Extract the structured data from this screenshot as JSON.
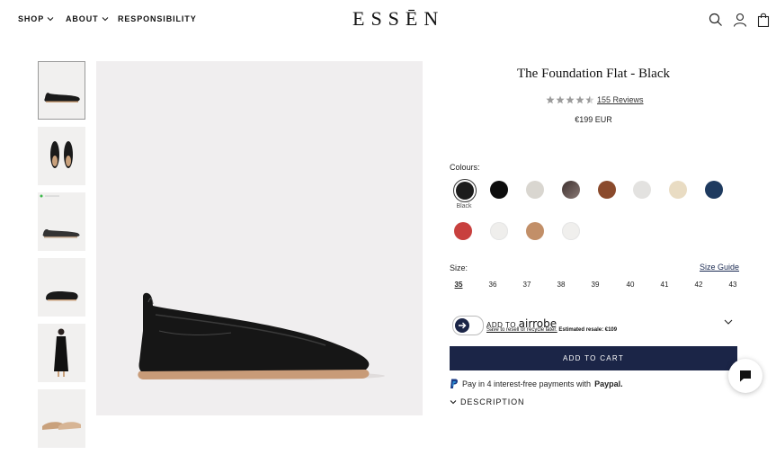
{
  "header": {
    "nav": [
      {
        "label": "SHOP",
        "has_dropdown": true
      },
      {
        "label": "ABOUT",
        "has_dropdown": true
      },
      {
        "label": "RESPONSIBILITY",
        "has_dropdown": false
      }
    ],
    "logo": "ESSĒN",
    "icons": [
      "search-icon",
      "account-icon",
      "cart-bag-icon"
    ]
  },
  "gallery": {
    "thumbnails": [
      "side-view",
      "top-view",
      "side-view-grey",
      "heel-view",
      "model-full-body",
      "pair-view"
    ],
    "selected_index": 0
  },
  "product": {
    "title": "The Foundation Flat - Black",
    "rating": 4.5,
    "reviews_label": "155 Reviews",
    "price": "€199 EUR"
  },
  "colours": {
    "label": "Colours:",
    "selected_name": "Black",
    "swatches": [
      "#1c1c1c",
      "#0d0d0d",
      "#d9d6d0",
      "#5e4c48",
      "#8a4a2c",
      "#e3e2e0",
      "#e9dcc3",
      "#1e3a5f",
      "#c8403e",
      "#efeeec",
      "#c28f68",
      "#f0efed"
    ]
  },
  "sizes": {
    "label": "Size:",
    "guide_label": "Size Guide",
    "options": [
      "35",
      "36",
      "37",
      "38",
      "39",
      "40",
      "41",
      "42",
      "43"
    ],
    "selected": "35"
  },
  "airrobe": {
    "add_to": "ADD TO",
    "brand": "airrobe",
    "link_text": "Save to resell or recycle later.",
    "resale_text": "Estimated resale: €109"
  },
  "cart": {
    "label": "ADD TO CART"
  },
  "paypal": {
    "text": "Pay in 4 interest-free payments with",
    "brand": "Paypal."
  },
  "description": {
    "label": "DESCRIPTION"
  },
  "colors": {
    "accent": "#1b2547",
    "gallery_bg": "#f0eeef"
  }
}
